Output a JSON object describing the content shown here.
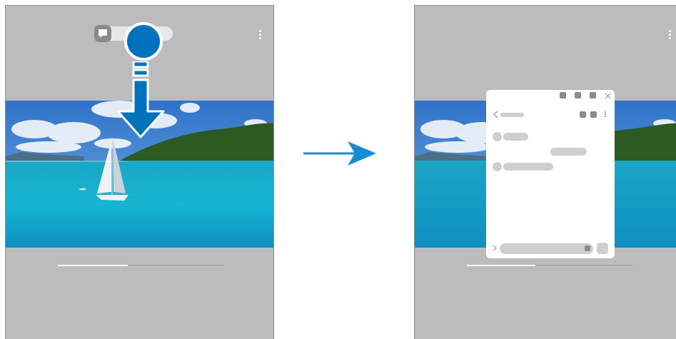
{
  "left_screen": {
    "menu_icon": "vertical-ellipsis-icon",
    "bubble_icon": "message-bubble-icon",
    "drag_handle": "drag-handle",
    "gesture": "swipe-down-arrow-icon"
  },
  "transition_arrow": "right-arrow-icon",
  "right_screen": {
    "menu_icon": "vertical-ellipsis-icon",
    "popup": {
      "back_icon": "chevron-left-icon",
      "close_icon": "close-icon",
      "expand_icon": "chevron-right-icon",
      "send_icon": "send-icon"
    }
  },
  "colors": {
    "accent": "#0072bc",
    "screen_bg": "#bcbcbe",
    "placeholder": "#cfcfcf"
  }
}
